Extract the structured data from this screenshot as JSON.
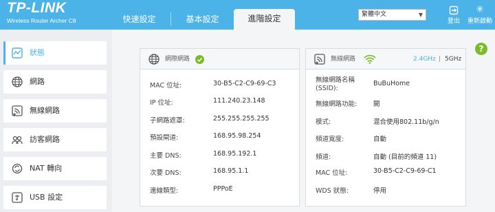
{
  "header": {
    "logo": "TP-LINK",
    "model": "Wireless Router Archer C8",
    "tabs": [
      {
        "label": "快速設定"
      },
      {
        "label": "基本設定"
      },
      {
        "label": "進階設定"
      }
    ],
    "language": "繁體中文",
    "logout_label": "登出",
    "reboot_label": "重新啟動"
  },
  "sidebar": {
    "items": [
      {
        "label": "狀態",
        "icon": "status-icon"
      },
      {
        "label": "網路",
        "icon": "globe-icon"
      },
      {
        "label": "無線網路",
        "icon": "wireless-icon"
      },
      {
        "label": "訪客網路",
        "icon": "guest-icon"
      },
      {
        "label": "NAT 轉向",
        "icon": "nat-icon"
      },
      {
        "label": "USB 設定",
        "icon": "usb-icon"
      }
    ]
  },
  "internet": {
    "title": "網際網路",
    "rows": [
      {
        "label": "MAC 位址:",
        "value": "30-B5-C2-C9-69-C3"
      },
      {
        "label": "IP 位址:",
        "value": "111.240.23.148"
      },
      {
        "label": "子網路遮罩:",
        "value": "255.255.255.255"
      },
      {
        "label": "預設閘道:",
        "value": "168.95.98.254"
      },
      {
        "label": "主要 DNS:",
        "value": "168.95.192.1"
      },
      {
        "label": "次要 DNS:",
        "value": "168.95.1.1"
      },
      {
        "label": "連線類型:",
        "value": "PPPoE"
      }
    ]
  },
  "wireless": {
    "title": "無線網路",
    "band_24": "2.4GHz",
    "band_sep": "|",
    "band_5": "5GHz",
    "rows": [
      {
        "label": "無線網路名稱",
        "label2": "(SSID):",
        "value": "BuBuHome"
      },
      {
        "label": "無線網路功能:",
        "value": "開"
      },
      {
        "label": "模式:",
        "value": "混合使用802.11b/g/n"
      },
      {
        "label": "頻道寬度:",
        "value": "自動"
      },
      {
        "label": "頻道:",
        "value": "自動 (目前的頻道 11)"
      },
      {
        "label": "MAC 位址:",
        "value": "30-B5-C2-C9-69-C1"
      },
      {
        "label": "WDS 狀態:",
        "value": "停用"
      }
    ]
  },
  "colors": {
    "accent": "#4bb3e7",
    "ok": "#7cbc2c"
  }
}
